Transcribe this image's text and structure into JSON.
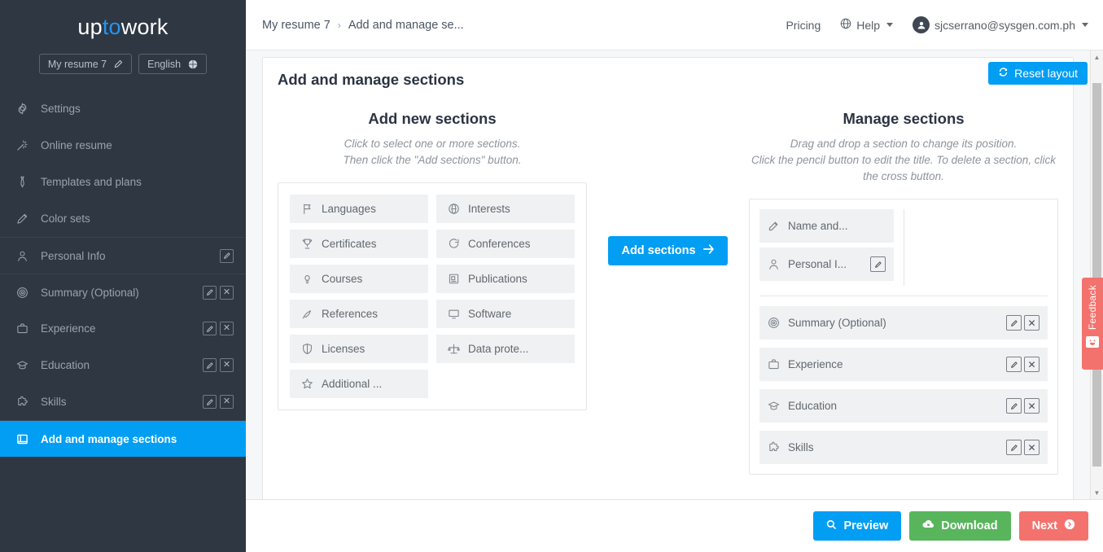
{
  "brand": {
    "text_1": "up",
    "text_2": "to",
    "text_3": "work",
    "accent": "#2196f3"
  },
  "sidebar": {
    "resume_button": {
      "label": "My resume 7",
      "icon": "pencil-icon"
    },
    "language_button": {
      "label": "English",
      "icon": "globe-icon"
    },
    "items": [
      {
        "label": "Settings",
        "icon": "gear-icon",
        "edit": false,
        "delete": false,
        "active": false
      },
      {
        "label": "Online resume",
        "icon": "magic-wand-icon",
        "edit": false,
        "delete": false,
        "active": false
      },
      {
        "label": "Templates and plans",
        "icon": "tie-icon",
        "edit": false,
        "delete": false,
        "active": false
      },
      {
        "label": "Color sets",
        "icon": "pencil-icon",
        "edit": false,
        "delete": false,
        "active": false
      },
      {
        "label": "Personal Info",
        "icon": "user-icon",
        "edit": true,
        "delete": false,
        "active": false
      },
      {
        "label": "Summary (Optional)",
        "icon": "target-icon",
        "edit": true,
        "delete": true,
        "active": false
      },
      {
        "label": "Experience",
        "icon": "briefcase-icon",
        "edit": true,
        "delete": true,
        "active": false
      },
      {
        "label": "Education",
        "icon": "graduation-cap-icon",
        "edit": true,
        "delete": true,
        "active": false
      },
      {
        "label": "Skills",
        "icon": "puzzle-icon",
        "edit": true,
        "delete": true,
        "active": false
      },
      {
        "label": "Add and manage sections",
        "icon": "layout-icon",
        "edit": false,
        "delete": false,
        "active": true
      }
    ]
  },
  "topbar": {
    "breadcrumb_1": "My resume 7",
    "breadcrumb_sep": "›",
    "breadcrumb_2": "Add and manage se...",
    "pricing": "Pricing",
    "help": "Help",
    "account": "sjcserrano@sysgen.com.ph"
  },
  "page": {
    "title": "Add and manage sections",
    "reset_layout": "Reset layout"
  },
  "add_panel": {
    "heading": "Add new sections",
    "sub_line_1": "Click to select one or more sections.",
    "sub_line_2": "Then click the \"Add sections\" button.",
    "chips": [
      {
        "label": "Languages",
        "icon": "flag-icon"
      },
      {
        "label": "Interests",
        "icon": "interests-icon"
      },
      {
        "label": "Certificates",
        "icon": "trophy-icon"
      },
      {
        "label": "Conferences",
        "icon": "speech-bubble-icon"
      },
      {
        "label": "Courses",
        "icon": "lightbulb-icon"
      },
      {
        "label": "Publications",
        "icon": "book-icon"
      },
      {
        "label": "References",
        "icon": "quill-icon"
      },
      {
        "label": "Software",
        "icon": "monitor-icon"
      },
      {
        "label": "Licenses",
        "icon": "shield-icon"
      },
      {
        "label": "Data prote...",
        "icon": "scales-icon"
      },
      {
        "label": "Additional ...",
        "icon": "star-icon"
      }
    ]
  },
  "add_sections_button": {
    "label": "Add sections",
    "icon": "arrow-right-icon"
  },
  "manage_panel": {
    "heading": "Manage sections",
    "sub_line_1": "Drag and drop a section to change its position.",
    "sub_line_2": "Click the pencil button to edit the title. To delete a section, click",
    "sub_line_3": "the cross button.",
    "fixed_rows": [
      {
        "label": "Name and...",
        "icon": "signature-icon",
        "edit": false,
        "delete": false
      },
      {
        "label": "Personal I...",
        "icon": "user-icon",
        "edit": true,
        "delete": false
      }
    ],
    "sortable_rows": [
      {
        "label": "Summary (Optional)",
        "icon": "target-icon",
        "edit": true,
        "delete": true
      },
      {
        "label": "Experience",
        "icon": "briefcase-icon",
        "edit": true,
        "delete": true
      },
      {
        "label": "Education",
        "icon": "graduation-cap-icon",
        "edit": true,
        "delete": true
      },
      {
        "label": "Skills",
        "icon": "puzzle-icon",
        "edit": true,
        "delete": true
      }
    ]
  },
  "footer": {
    "preview": "Preview",
    "download": "Download",
    "next": "Next"
  },
  "feedback": {
    "label": "Feedback",
    "icon": "smiley-icon",
    "color": "#f4726d"
  },
  "colors": {
    "sidebar_bg": "#2f3742",
    "accent_blue": "#029ef4",
    "green": "#58b55c",
    "red": "#f4726d"
  }
}
